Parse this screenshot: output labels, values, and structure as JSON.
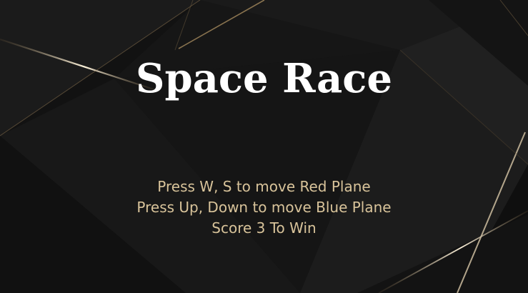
{
  "game": {
    "title": "Space Race",
    "instructions": [
      "Press W, S to move Red Plane",
      "Press Up, Down to move Blue Plane",
      "Score 3 To Win"
    ]
  },
  "colors": {
    "background": "#151515",
    "title": "#ffffff",
    "instructions": "#d8c39a",
    "accent_gold": "#c9a978"
  }
}
